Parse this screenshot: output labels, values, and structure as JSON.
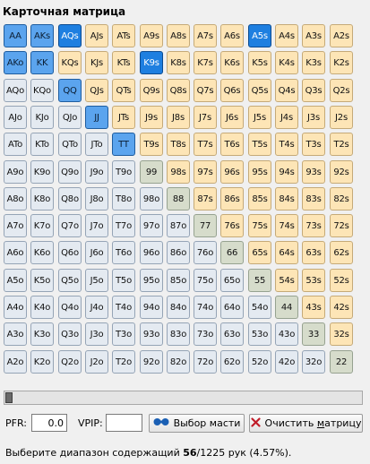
{
  "title": "Карточная матрица",
  "ranks": [
    "A",
    "K",
    "Q",
    "J",
    "T",
    "9",
    "8",
    "7",
    "6",
    "5",
    "4",
    "3",
    "2"
  ],
  "selected": [
    "AA",
    "AKs",
    "AQs",
    "A5s",
    "AKo",
    "KK",
    "K9s",
    "QQ",
    "JJ",
    "TT"
  ],
  "selected_dark": [
    "AQs",
    "A5s",
    "K9s"
  ],
  "pfr": {
    "label": "PFR:",
    "value": "0.0"
  },
  "vpip": {
    "label": "VPIP:",
    "value": ""
  },
  "buttons": {
    "suit_select": "Выбор масти",
    "clear_matrix_pre": "Очистить ",
    "clear_matrix_u": "м",
    "clear_matrix_post": "атрицу"
  },
  "status": {
    "prefix": "Выберите диапазон содержащий ",
    "count": "56",
    "suffix": "/1225 рук (4.57%)."
  },
  "colors": {
    "pair": "#d6dccb",
    "suited": "#fde5b6",
    "offsuit": "#e4eaf1",
    "selected": "#5ba4ee",
    "selected_dark": "#1e7fe0"
  },
  "slider": {
    "value": 0
  }
}
